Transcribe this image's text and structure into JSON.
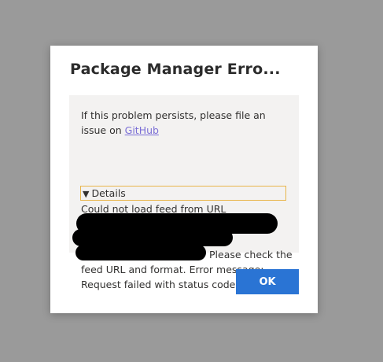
{
  "dialog": {
    "title": "Package Manager Erro...",
    "message_prefix": "If this problem persists, please file an issue on ",
    "message_link": "GitHub",
    "details_arrow": "▼",
    "details_label": "Details",
    "error_line_start": "Could not load feed from URL",
    "error_line_rest": "Please check the feed URL and format. Error message: Request failed with status code 401",
    "ok_label": "OK"
  },
  "colors": {
    "backdrop": "#9a9a9a",
    "accent_button": "#2a74d4",
    "link": "#7b6fd6",
    "focus_outline": "#e8b54a",
    "message_background": "#f3f2f1"
  }
}
